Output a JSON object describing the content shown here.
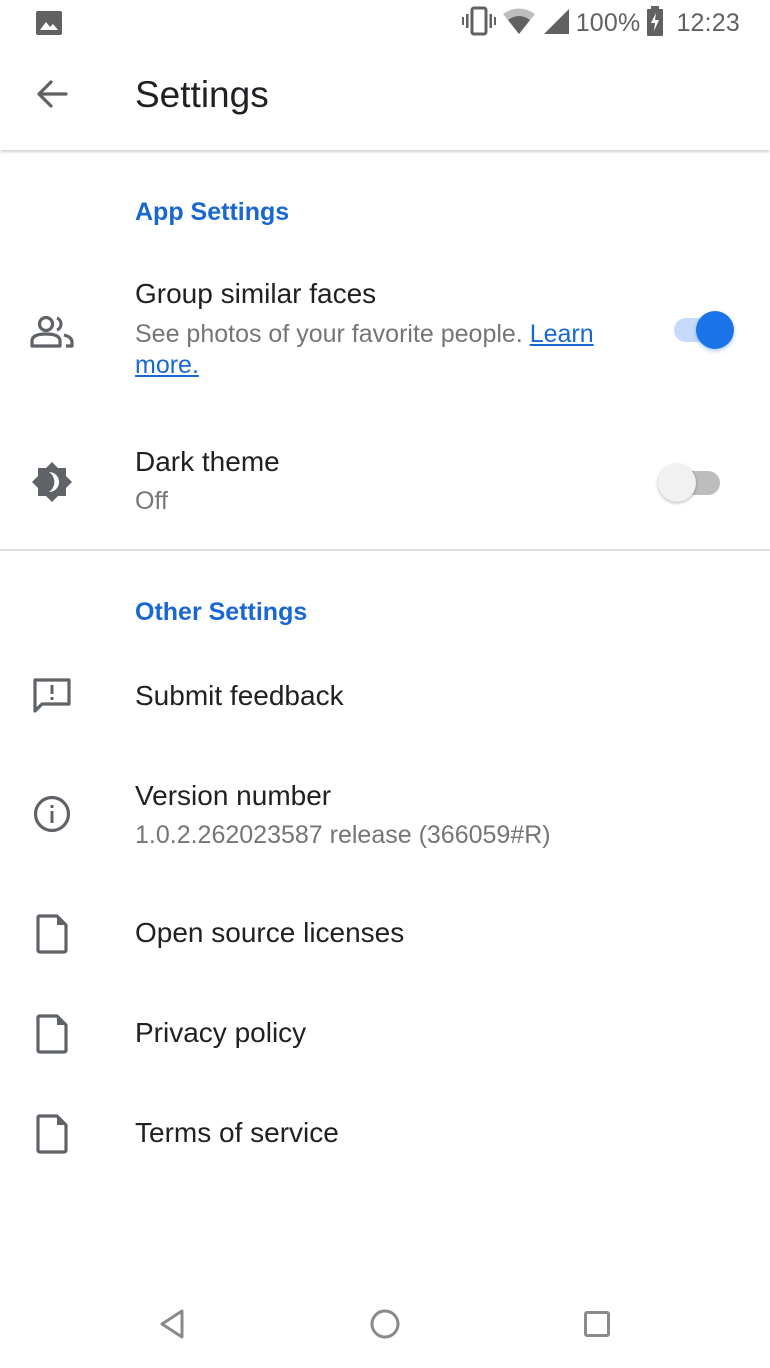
{
  "status_bar": {
    "left_icon": "image-icon",
    "icons": [
      "vibrate-icon",
      "wifi-icon",
      "cell-signal-icon",
      "battery-charging-icon"
    ],
    "battery": "100%",
    "time": "12:23"
  },
  "app_bar": {
    "back_icon": "arrow-back-icon",
    "title": "Settings"
  },
  "sections": [
    {
      "header": "App Settings",
      "items": [
        {
          "icon": "people-icon",
          "title": "Group similar faces",
          "subtitle": "See photos of your favorite people.",
          "link": "Learn more.",
          "toggle": true
        },
        {
          "icon": "brightness-icon",
          "title": "Dark theme",
          "subtitle": "Off",
          "toggle": false
        }
      ]
    },
    {
      "header": "Other Settings",
      "items": [
        {
          "icon": "feedback-icon",
          "title": "Submit feedback"
        },
        {
          "icon": "info-icon",
          "title": "Version number",
          "subtitle": "1.0.2.262023587 release (366059#R)"
        },
        {
          "icon": "file-icon",
          "title": "Open source licenses"
        },
        {
          "icon": "file-icon",
          "title": "Privacy policy"
        },
        {
          "icon": "file-icon",
          "title": "Terms of service"
        }
      ]
    }
  ],
  "nav_bar": {
    "buttons": [
      "back-triangle-icon",
      "home-circle-icon",
      "recents-square-icon"
    ]
  },
  "colors": {
    "accent": "#1a73e8",
    "section_header": "#1967d2",
    "icon_gray": "#5f6368",
    "subtitle_gray": "#757575"
  }
}
